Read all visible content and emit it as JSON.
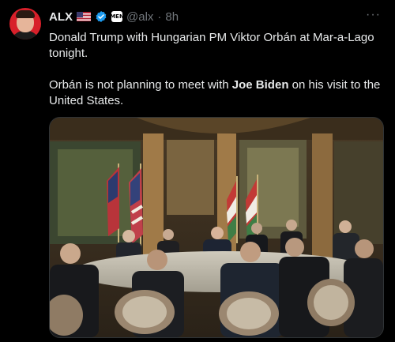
{
  "tweet": {
    "author_name": "ALX",
    "handle": "@alx",
    "separator": "·",
    "time": "8h",
    "more_label": "···",
    "affiliate_badge": "MEN",
    "flag_icon": "us-flag-icon",
    "verified_icon": "verified-badge-icon",
    "text_line1_prefix": "Donald Trump with Hungarian PM Viktor Orbán at Mar-a-Lago tonight.",
    "text_p2_before": "Orbán is not planning to meet with ",
    "text_p2_bold": "Joe Biden",
    "text_p2_after": " on his visit to the United States."
  },
  "colors": {
    "background": "#000000",
    "text": "#e7e9ea",
    "muted": "#71767b",
    "verified": "#1d9bf0",
    "avatar_bg": "#d8202a"
  }
}
